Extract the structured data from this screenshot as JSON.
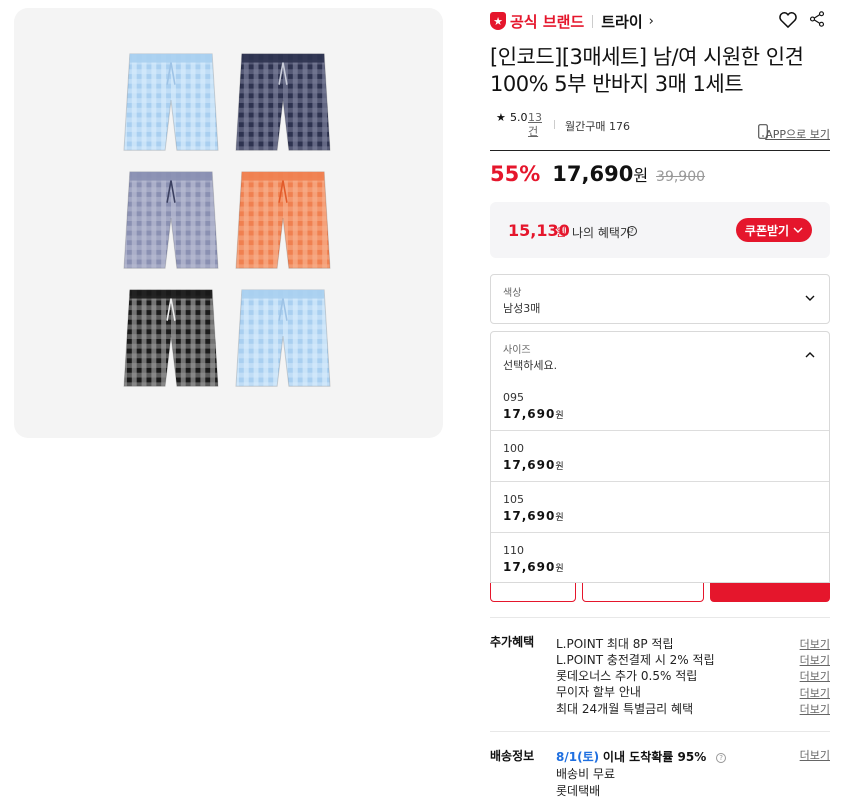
{
  "product_images": {
    "shorts": [
      {
        "color": "#a9cff0",
        "check": "#d8ecfb",
        "string": "#9ec3e6"
      },
      {
        "color": "#2e3350",
        "check": "#7b7f9a",
        "string": "#c9ccd9"
      },
      {
        "color": "#8a90b2",
        "check": "#b9bdd4",
        "string": "#3b4060"
      },
      {
        "color": "#f08050",
        "check": "#f7b08c",
        "string": "#e25b2a"
      },
      {
        "color": "#1a1a1a",
        "check": "#9a9a9a",
        "string": "#eeeeee"
      },
      {
        "color": "#a9cff0",
        "check": "#d8ecfb",
        "string": "#9ec3e6"
      }
    ]
  },
  "brand": {
    "badge_label": "공식 브랜드",
    "name": "트라이",
    "chevron": "›"
  },
  "title": "[인코드][3매세트] 남/여 시원한 인견 100% 5부 반바지 3매 1세트",
  "rating": {
    "star": "★",
    "score": "5.0",
    "reviews": "13건",
    "monthly": "월간구매 176",
    "app_view": "APP으로 보기"
  },
  "price": {
    "discount": "55%",
    "sale": "17,690",
    "won": "원",
    "original": "39,900"
  },
  "benefit": {
    "price": "15,130",
    "won": "원",
    "label": "나의 혜택가",
    "help": "?",
    "coupon_button": "쿠폰받기"
  },
  "color_select": {
    "label": "색상",
    "value": "남성3매"
  },
  "size_select": {
    "label": "사이즈",
    "placeholder": "선택하세요."
  },
  "size_options": [
    {
      "size": "095",
      "price": "17,690",
      "won": "원"
    },
    {
      "size": "100",
      "price": "17,690",
      "won": "원"
    },
    {
      "size": "105",
      "price": "17,690",
      "won": "원"
    },
    {
      "size": "110",
      "price": "17,690",
      "won": "원"
    }
  ],
  "extra_benefits": {
    "title": "추가혜택",
    "more": "더보기",
    "items": [
      "L.POINT 최대 8P 적립",
      "L.POINT 충전결제 시 2% 적립",
      "롯데오너스 추가 0.5% 적립",
      "무이자 할부 안내",
      "최대 24개월 특별금리 혜택"
    ]
  },
  "shipping": {
    "title": "배송정보",
    "more": "더보기",
    "date": "8/1(토)",
    "arrival": "이내 도착확률 95%",
    "help": "?",
    "fee": "배송비 무료",
    "carrier": "롯데택배"
  },
  "colors": {
    "accent": "#e5162c",
    "link_blue": "#1f6fe0"
  }
}
